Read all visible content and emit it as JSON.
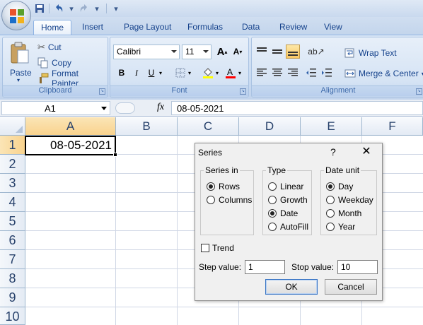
{
  "qat": {
    "save": "save-icon",
    "undo": "undo-icon",
    "redo": "redo-icon"
  },
  "tabs": [
    "Home",
    "Insert",
    "Page Layout",
    "Formulas",
    "Data",
    "Review",
    "View"
  ],
  "clipboard": {
    "paste": "Paste",
    "cut": "Cut",
    "copy": "Copy",
    "format_painter": "Format Painter",
    "label": "Clipboard"
  },
  "font": {
    "name": "Calibri",
    "size": "11",
    "grow": "A",
    "shrink": "A",
    "bold": "B",
    "italic": "I",
    "underline": "U",
    "label": "Font"
  },
  "alignment": {
    "wrap_text": "Wrap Text",
    "merge_center": "Merge & Center",
    "label": "Alignment"
  },
  "formula_bar": {
    "cell_ref": "A1",
    "fx": "fx",
    "formula": "08-05-2021"
  },
  "columns": [
    "A",
    "B",
    "C",
    "D",
    "E",
    "F"
  ],
  "rows": [
    "1",
    "2",
    "3",
    "4",
    "5",
    "6",
    "7",
    "8",
    "9",
    "10"
  ],
  "cells": {
    "A1": "08-05-2021"
  },
  "dialog": {
    "title": "Series",
    "help": "?",
    "close": "✕",
    "series_in": {
      "label": "Series in",
      "options": [
        "Rows",
        "Columns"
      ],
      "selected": "Rows"
    },
    "type": {
      "label": "Type",
      "options": [
        "Linear",
        "Growth",
        "Date",
        "AutoFill"
      ],
      "selected": "Date"
    },
    "date_unit": {
      "label": "Date unit",
      "options": [
        "Day",
        "Weekday",
        "Month",
        "Year"
      ],
      "selected": "Day"
    },
    "trend": {
      "label": "Trend",
      "checked": false
    },
    "step_value": {
      "label": "Step value:",
      "value": "1"
    },
    "stop_value": {
      "label": "Stop value:",
      "value": "10"
    },
    "ok": "OK",
    "cancel": "Cancel"
  }
}
